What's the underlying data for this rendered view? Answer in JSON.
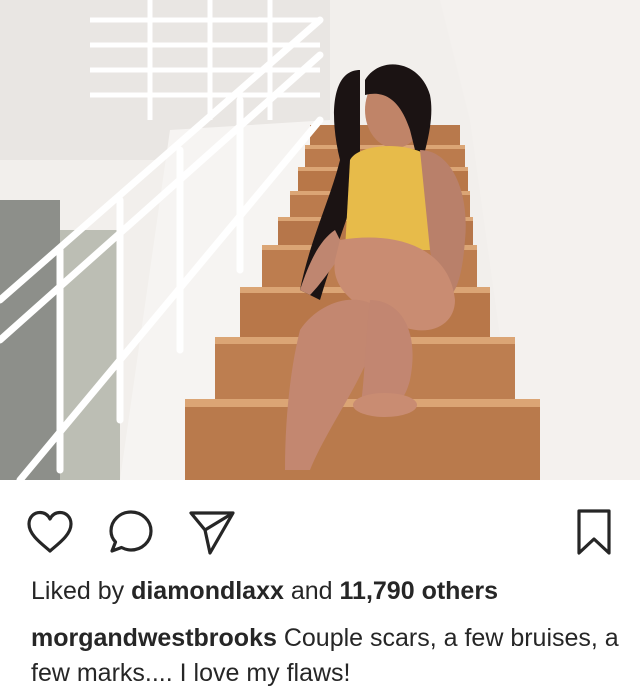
{
  "post": {
    "image": {
      "description": "photo-stairs",
      "colors": {
        "wall": "#f1eeeb",
        "stair_wood": "#b97a4c",
        "stair_edge": "#d9a274",
        "railing": "#ffffff",
        "top": "#e6b84a",
        "hair": "#1a1212",
        "skin": "#c98c72"
      }
    },
    "actions": {
      "like_icon": "heart-icon",
      "comment_icon": "comment-bubble-icon",
      "share_icon": "paper-plane-icon",
      "save_icon": "bookmark-icon",
      "icon_color": "#262626"
    },
    "likes": {
      "prefix": "Liked by",
      "user": "diamondlaxx",
      "middle": "and",
      "count": "11,790 others"
    },
    "caption": {
      "username": "morgandwestbrooks",
      "text": "Couple scars, a few bruises, a few marks.... I love my flaws!"
    }
  }
}
